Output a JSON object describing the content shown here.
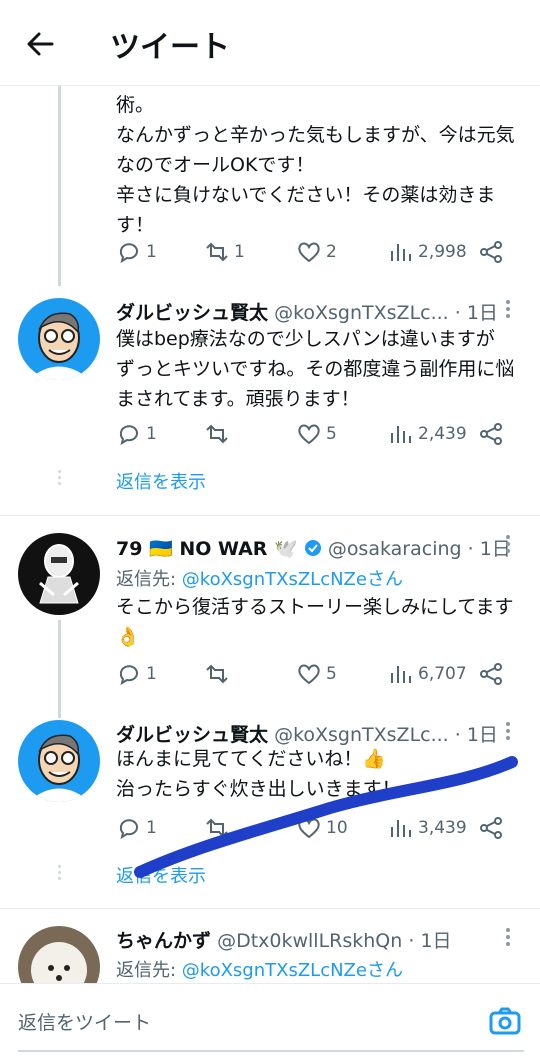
{
  "header": {
    "title": "ツイート"
  },
  "first_tweet": {
    "lines": [
      "術。",
      "なんかずっと辛かった気もしますが、今は元気",
      "なのでオールOKです！",
      "辛さに負けないでください！その薬は効きま",
      "す！"
    ],
    "replies": "1",
    "retweets": "1",
    "likes": "2",
    "views": "2,998"
  },
  "reply1": {
    "name": "ダルビッシュ賢太",
    "handle": "@koXsgnTXsZLc...",
    "time": "· 1日",
    "lines": [
      "僕はbep療法なので少しスパンは違いますが",
      "ずっとキツいですね。その都度違う副作用に悩",
      "まされてます。頑張ります！"
    ],
    "replies": "1",
    "retweets": "",
    "likes": "5",
    "views": "2,439",
    "show_replies": "返信を表示"
  },
  "tweet2": {
    "name": "79 🇺🇦 NO WAR 🕊️",
    "handle": "@osakaracing",
    "time": "· 1日",
    "replying_prefix": "返信先: ",
    "replying_handle": "@koXsgnTXsZLcNZeさん",
    "lines": [
      "そこから復活するストーリー楽しみにしてます",
      "👌"
    ],
    "replies": "1",
    "retweets": "",
    "likes": "5",
    "views": "6,707"
  },
  "reply2": {
    "name": "ダルビッシュ賢太",
    "handle": "@koXsgnTXsZLc...",
    "time": "· 1日",
    "lines": [
      "ほんまに見ててくださいね！👍",
      "治ったらすぐ炊き出しいきます！"
    ],
    "replies": "1",
    "retweets": "",
    "likes": "10",
    "views": "3,439",
    "show_replies": "返信を表示"
  },
  "tweet3": {
    "name": "ちゃんかず",
    "handle": "@Dtx0kwllLRskhQn",
    "time": "· 1日",
    "replying_prefix": "返信先: ",
    "replying_handle": "@koXsgnTXsZLcNZeさん"
  },
  "reply_bar": {
    "placeholder": "返信をツイート"
  },
  "colors": {
    "accent": "#1d9bf0",
    "scribble": "#1f3fc9"
  }
}
